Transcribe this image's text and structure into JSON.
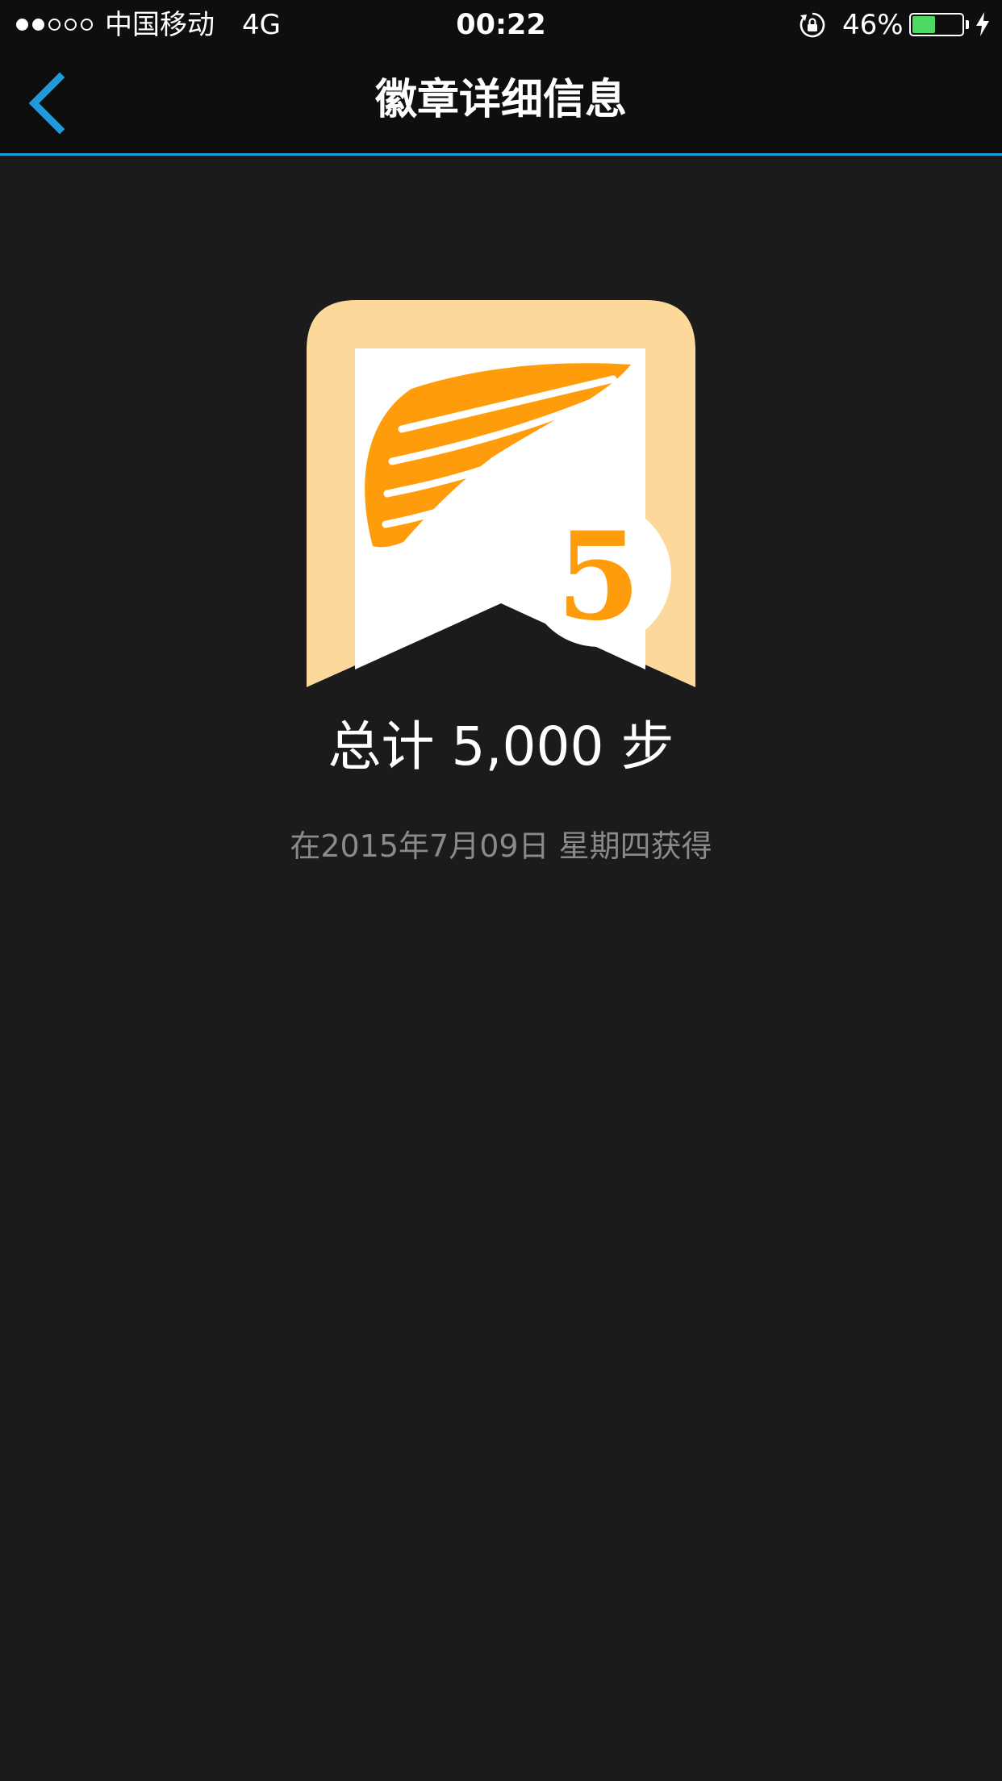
{
  "status_bar": {
    "carrier": "中国移动",
    "network": "4G",
    "time": "00:22",
    "battery_percent": "46%",
    "battery_level": 0.46,
    "signal_strength_bars": 2,
    "signal_total_bars": 5,
    "icons": [
      "signal-icon",
      "orientation-lock-icon",
      "battery-icon",
      "charging-icon"
    ]
  },
  "nav_bar": {
    "title": "徽章详细信息",
    "back_icon": "chevron-left-icon"
  },
  "badge": {
    "number": "5",
    "icon": "wing-icon",
    "title": "总计 5,000 步",
    "earned_date": "在2015年7月09日 星期四获得"
  },
  "colors": {
    "background": "#1b1b1b",
    "bar_background": "#0e0e0e",
    "accent": "#1f9bd9",
    "badge_frame": "#fdd89b",
    "badge_orange": "#ff9c0c",
    "battery_green": "#4cd964",
    "secondary_text": "#8a8a8a"
  }
}
